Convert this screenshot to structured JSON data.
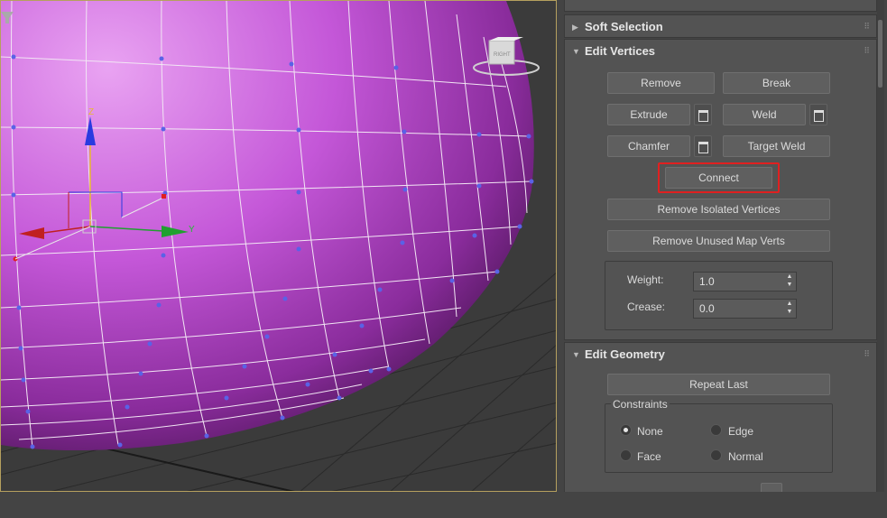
{
  "viewport": {
    "gizmo": {
      "z_label": "Z",
      "y_label": "Y"
    },
    "viewcube_label": "RIGHT"
  },
  "panel": {
    "soft_selection": {
      "title": "Soft Selection",
      "expanded": false
    },
    "edit_vertices": {
      "title": "Edit Vertices",
      "expanded": true,
      "buttons": {
        "remove": "Remove",
        "break": "Break",
        "extrude": "Extrude",
        "weld": "Weld",
        "chamfer": "Chamfer",
        "target_weld": "Target Weld",
        "connect": "Connect",
        "remove_isolated": "Remove Isolated Vertices",
        "remove_unused_map": "Remove Unused Map Verts"
      },
      "weight": {
        "label": "Weight:",
        "value": "1.0"
      },
      "crease": {
        "label": "Crease:",
        "value": "0.0"
      }
    },
    "edit_geometry": {
      "title": "Edit Geometry",
      "expanded": true,
      "repeat_last": "Repeat Last",
      "constraints": {
        "label": "Constraints",
        "options": {
          "none": "None",
          "edge": "Edge",
          "face": "Face",
          "normal": "Normal"
        },
        "selected": "None"
      }
    }
  },
  "colors": {
    "highlight": "#e02020",
    "mesh": "#c256d6",
    "viewport_border": "#b5a05e"
  }
}
